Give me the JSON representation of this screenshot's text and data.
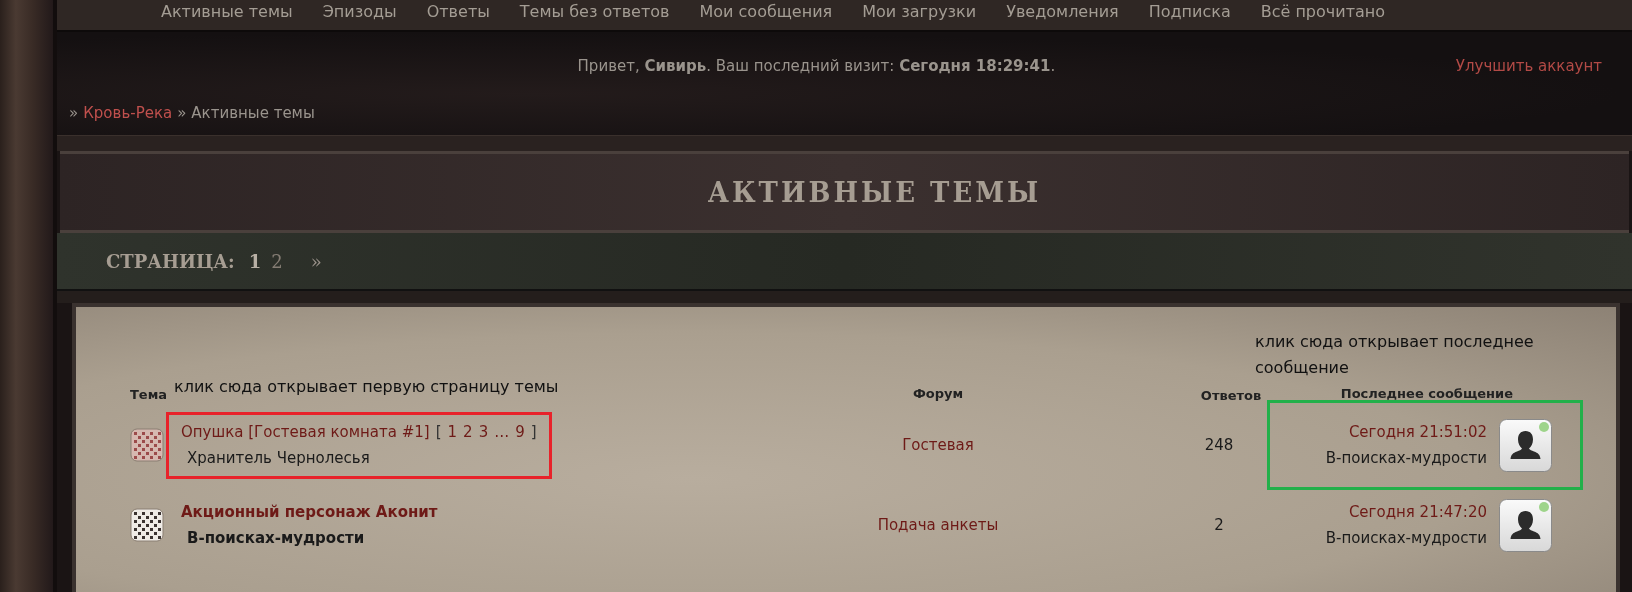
{
  "nav": {
    "items": [
      "Активные темы",
      "Эпизоды",
      "Ответы",
      "Темы без ответов",
      "Мои сообщения",
      "Мои загрузки",
      "Уведомления",
      "Подписка",
      "Всё прочитано"
    ]
  },
  "greeting": "Привет, **Сивирь**. Ваш последний визит: **Сегодня 18:29:41**.",
  "upgrade_link": "Улучшить аккаунт",
  "breadcrumb": [
    {
      "separator": "»",
      "text": "Кровь-Река",
      "kind": "link"
    },
    {
      "separator": "»",
      "text": "Активные темы",
      "kind": "current"
    }
  ],
  "page_title": "АКТИВНЫЕ ТЕМЫ",
  "pagination": {
    "label": "СТРАНИЦА:",
    "pages": [
      {
        "label": "1",
        "selected": true
      },
      {
        "label": "2",
        "selected": false
      }
    ],
    "next": "»"
  },
  "annotations": [
    "клик сюда открывает первую страницу темы",
    "клик сюда открывает последнее сообщение"
  ],
  "table": {
    "columns": [
      "Тема",
      "Форум",
      "Ответов",
      "Последнее сообщение"
    ],
    "rows": [
      {
        "title": "Опушка [Гостевая комната #1]",
        "pages_open": "[",
        "pages": [
          "1",
          "2",
          "3",
          "…",
          "9"
        ],
        "pages_close": "]",
        "author": "Хранитель Чернолесья",
        "unread": false,
        "forum": "Гостевая",
        "replies": "248",
        "last_time": "Сегодня 21:51:02",
        "last_author": "В-поисках-мудрости",
        "online": true,
        "topic_boxed": true,
        "last_boxed": true
      },
      {
        "title": "Акционный персонаж Аконит",
        "author": "В-поисках-мудрости",
        "unread": true,
        "forum": "Подача анкеты",
        "replies": "2",
        "last_time": "Сегодня 21:47:20",
        "last_author": "В-поисках-мудрости",
        "online": true,
        "topic_boxed": false,
        "last_boxed": false
      }
    ]
  }
}
